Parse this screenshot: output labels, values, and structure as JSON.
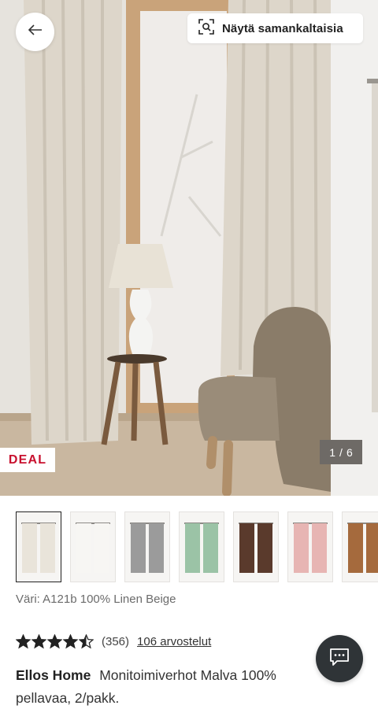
{
  "header": {
    "back_label": "Back",
    "similar_button_label": "Näytä samankaltaisia"
  },
  "gallery": {
    "badge": "DEAL",
    "current_index": "1",
    "separator": "/",
    "total": "6"
  },
  "thumbnails": [
    {
      "colour": "#e9e4da",
      "selected": true
    },
    {
      "colour": "#f7f6f3",
      "selected": false
    },
    {
      "colour": "#9b9b9b",
      "selected": false
    },
    {
      "colour": "#9bc3a6",
      "selected": false
    },
    {
      "colour": "#5a3a2c",
      "selected": false
    },
    {
      "colour": "#e7b5b3",
      "selected": false
    },
    {
      "colour": "#a56a3d",
      "selected": false
    }
  ],
  "product": {
    "colour_text": "Väri: A121b 100% Linen Beige",
    "rating": 4.5,
    "rating_count": "(356)",
    "reviews_link": "106 arvostelut",
    "brand": "Ellos Home",
    "name": "Monitoimiverhot Malva 100% pellavaa, 2/pakk."
  },
  "icons": {
    "back": "arrow-left-icon",
    "similar": "visual-search-icon",
    "chat": "chat-icon",
    "star": "star-icon"
  },
  "colors": {
    "deal_red": "#c8102e",
    "chat_bg": "#2f3437",
    "counter_bg": "#6e6a66"
  }
}
